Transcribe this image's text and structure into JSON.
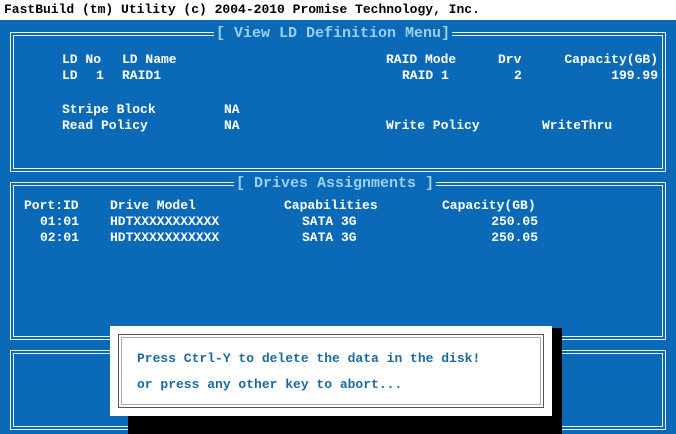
{
  "title_bar": "FastBuild (tm) Utility (c) 2004-2010 Promise Technology, Inc.",
  "ld_panel": {
    "title": "[ View LD Definition Menu]",
    "headers": {
      "ld_no": "LD No",
      "ld_name": "LD Name",
      "raid_mode": "RAID Mode",
      "drv": "Drv",
      "capacity": "Capacity(GB)"
    },
    "row": {
      "ld": "LD",
      "number": "1",
      "name": "RAID1",
      "raid_mode": "RAID 1",
      "drv": "2",
      "capacity": "199.99"
    },
    "stripe_block_label": "Stripe Block",
    "stripe_block_value": "NA",
    "read_policy_label": "Read Policy",
    "read_policy_value": "NA",
    "write_policy_label": "Write Policy",
    "write_policy_value": "WriteThru"
  },
  "drives_panel": {
    "title": "[ Drives Assignments ]",
    "headers": {
      "port_id": "Port:ID",
      "drive_model": "Drive Model",
      "capabilities": "Capabilities",
      "capacity": "Capacity(GB)"
    },
    "rows": [
      {
        "port_id": "01:01",
        "drive_model": "HDTXXXXXXXXXXX",
        "capabilities": "SATA 3G",
        "capacity": "250.05"
      },
      {
        "port_id": "02:01",
        "drive_model": "HDTXXXXXXXXXXX",
        "capabilities": "SATA 3G",
        "capacity": "250.05"
      }
    ]
  },
  "dialog": {
    "line1": "Press Ctrl-Y to delete the data in the disk!",
    "line2": "or press any other key to abort..."
  },
  "colors": {
    "background": "#0b6ab8",
    "text": "#ffffff",
    "panel_title": "#9ad0f8",
    "dialog_text": "#1a6a9f"
  }
}
